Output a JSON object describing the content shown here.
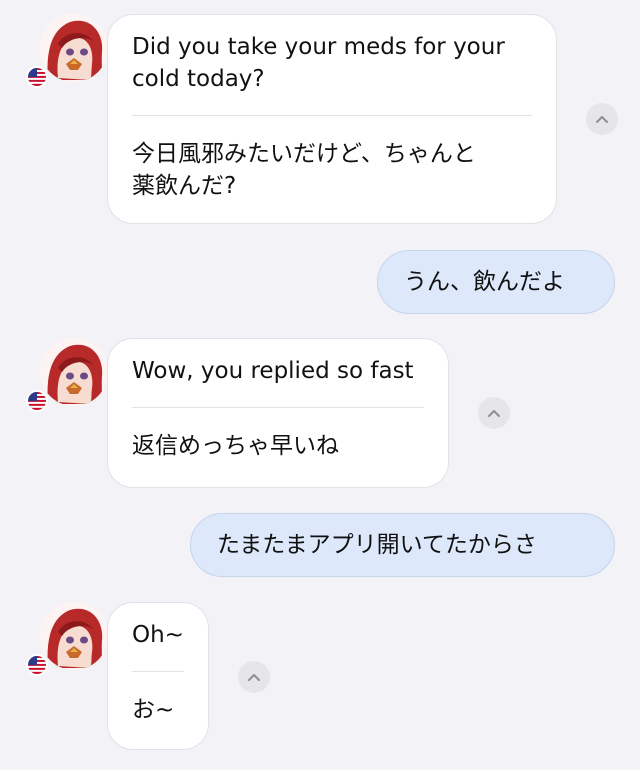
{
  "messages": [
    {
      "direction": "incoming",
      "original": "Did you take your meds for your cold today?",
      "original_line1": "Did you take your meds for your",
      "original_line2": "cold today?",
      "translation_line1": "今日風邪みたいだけど、ちゃんと",
      "translation_line2": "薬飲んだ?"
    },
    {
      "direction": "outgoing",
      "text": "うん、飲んだよ"
    },
    {
      "direction": "incoming",
      "original_line1": "Wow, you replied so fast",
      "translation_line1": "返信めっちゃ早いね"
    },
    {
      "direction": "outgoing",
      "text": "たまたまアプリ開いてたからさ"
    },
    {
      "direction": "incoming",
      "original_line1": "Oh~",
      "translation_line1": "お~"
    }
  ],
  "icons": {
    "avatar": "anime-girl-red-hair-avatar",
    "flag": "us-flag-icon",
    "collapse": "chevron-up-icon"
  },
  "colors": {
    "background": "#f2f2f7",
    "incoming_bubble": "#ffffff",
    "outgoing_bubble": "#dde8fa",
    "text": "#111111"
  }
}
